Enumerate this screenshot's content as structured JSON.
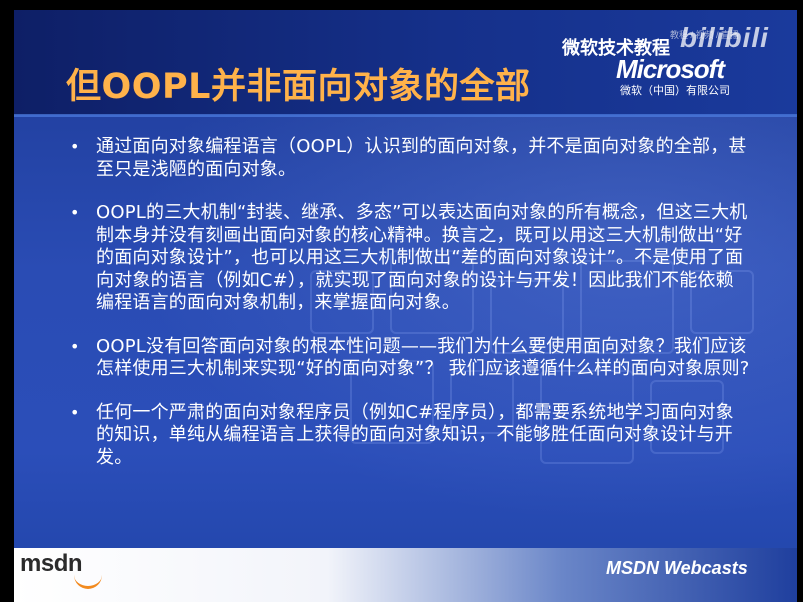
{
  "title": "但OOPL并非面向对象的全部",
  "brand": {
    "course_label": "微软技术教程",
    "logo_text": "Microsoft",
    "company": "微软（中国）有限公司",
    "watermark": "bilibili",
    "watermark_small": "教程 / 视频 / 直播"
  },
  "bullets": [
    "通过面向对象编程语言（OOPL）认识到的面向对象，并不是面向对象的全部，甚至只是浅陋的面向对象。",
    "OOPL的三大机制“封装、继承、多态”可以表达面向对象的所有概念，但这三大机制本身并没有刻画出面向对象的核心精神。换言之，既可以用这三大机制做出“好的面向对象设计”，也可以用这三大机制做出“差的面向对象设计”。不是使用了面向对象的语言（例如C#），就实现了面向对象的设计与开发！因此我们不能依赖编程语言的面向对象机制，来掌握面向对象。",
    "OOPL没有回答面向对象的根本性问题——我们为什么要使用面向对象？我们应该怎样使用三大机制来实现“好的面向对象”？ 我们应该遵循什么样的面向对象原则?",
    "任何一个严肃的面向对象程序员（例如C#程序员），都需要系统地学习面向对象的知识，单纯从编程语言上获得的面向对象知识，不能够胜任面向对象设计与开发。"
  ],
  "footer": {
    "msdn_logo": "msdn",
    "webcasts_label": "MSDN Webcasts"
  },
  "colors": {
    "title": "#ffb24a",
    "background": "#2a4cb4",
    "text": "#ffffff",
    "accent_swoosh": "#f28a1f"
  }
}
